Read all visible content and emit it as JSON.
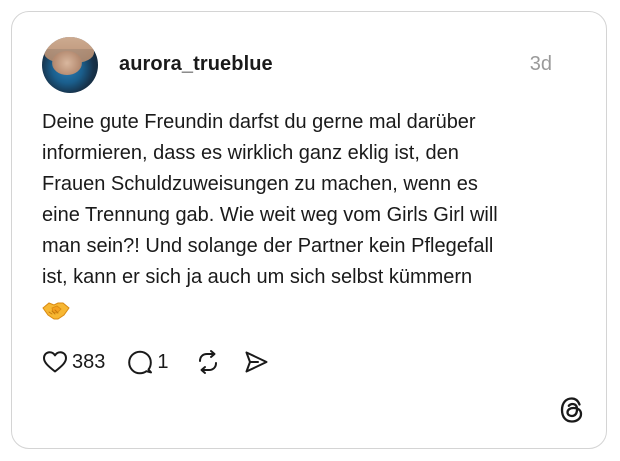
{
  "post": {
    "username": "aurora_trueblue",
    "time": "3d",
    "text_lines": [
      "Deine gute Freundin darfst du gerne mal darüber",
      "informieren, dass es wirklich ganz eklig ist, den",
      "Frauen Schuldzuweisungen zu machen, wenn es",
      "eine Trennung gab. Wie weit weg vom Girls Girl will",
      "man sein?! Und solange der Partner kein Pflegefall",
      "ist, kann er sich ja auch um sich selbst kümmern"
    ],
    "emoji": "handshake-emoji",
    "likes": "383",
    "replies": "1"
  },
  "icons": {
    "like": "heart-icon",
    "reply": "comment-bubble-icon",
    "repost": "repost-icon",
    "share": "send-icon",
    "brand": "threads-logo-icon"
  }
}
